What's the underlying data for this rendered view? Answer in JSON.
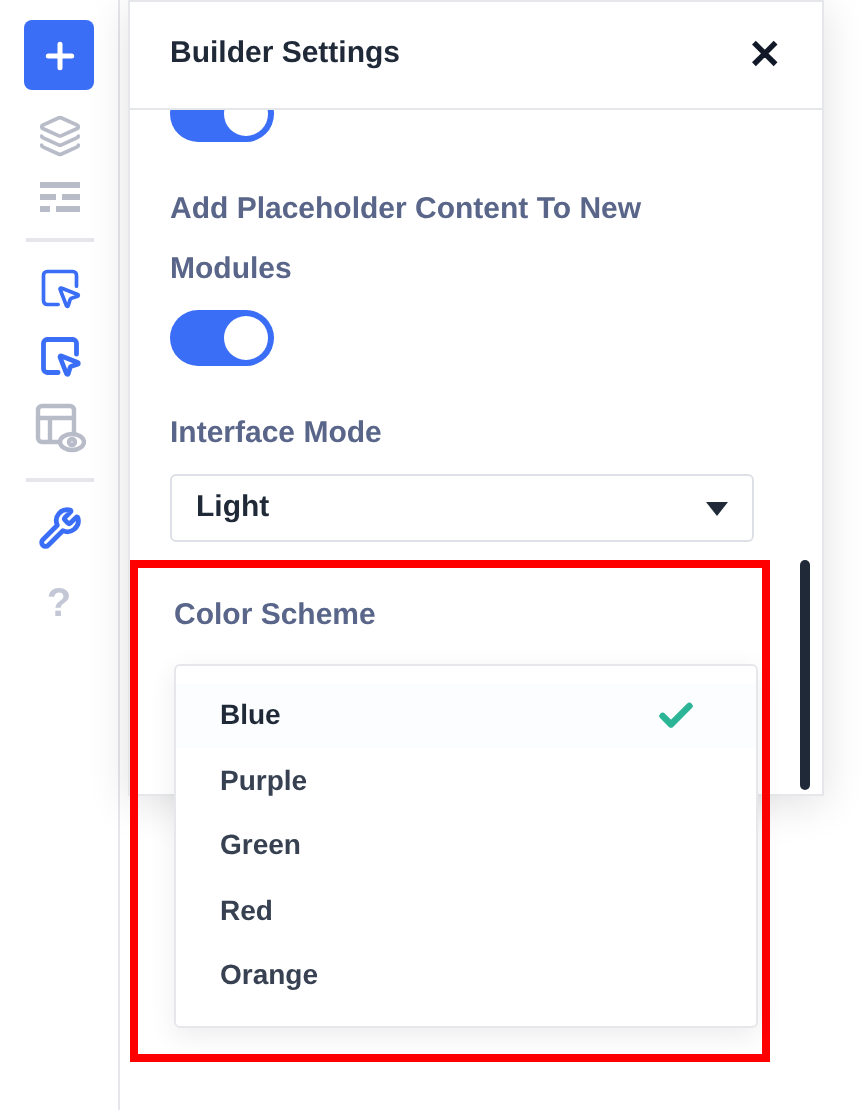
{
  "sidebar": {
    "help_glyph": "?"
  },
  "panel": {
    "title": "Builder Settings",
    "close_glyph": "✕",
    "scrolled_toggle": {
      "on": true
    },
    "settings": [
      {
        "kind": "toggle",
        "label": "Add Placeholder Content To New Modules",
        "on": true
      },
      {
        "kind": "select",
        "label": "Interface Mode",
        "value": "Light"
      }
    ]
  },
  "color_scheme": {
    "label": "Color Scheme",
    "highlighted": true,
    "options": [
      {
        "label": "Blue",
        "selected": true
      },
      {
        "label": "Purple",
        "selected": false
      },
      {
        "label": "Green",
        "selected": false
      },
      {
        "label": "Red",
        "selected": false
      },
      {
        "label": "Orange",
        "selected": false
      }
    ]
  }
}
